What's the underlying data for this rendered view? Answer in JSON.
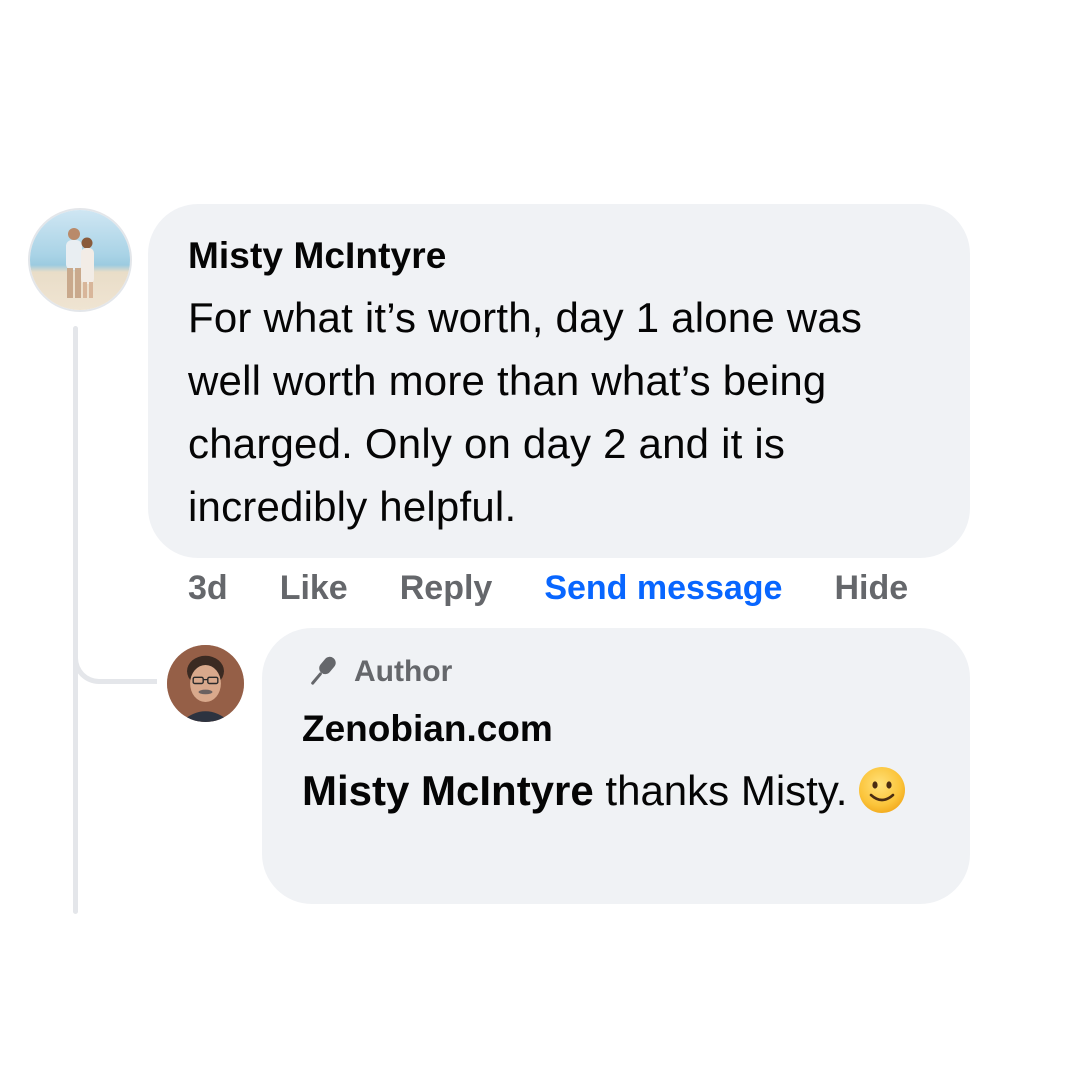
{
  "comment": {
    "author": "Misty McIntyre",
    "text": "For what it’s worth, day 1 alone was well worth more than what’s being charged. Only on day 2 and it is incredibly helpful.",
    "avatar_icon": "profile-photo-couple-beach",
    "actions": {
      "time": "3d",
      "like": "Like",
      "reply": "Reply",
      "send_message": "Send message",
      "hide": "Hide"
    }
  },
  "reply": {
    "badge_icon": "microphone-icon",
    "badge_label": "Author",
    "author": "Zenobian.com",
    "mention": "Misty McIntyre",
    "text_after_mention": " thanks Misty.",
    "emoji": "slightly-smiling-face",
    "avatar_icon": "profile-photo-man-glasses"
  },
  "colors": {
    "bubble_bg": "#f0f2f5",
    "text": "#050505",
    "muted": "#65676b",
    "link_blue": "#0866ff",
    "thread_line": "#e4e6ea"
  }
}
